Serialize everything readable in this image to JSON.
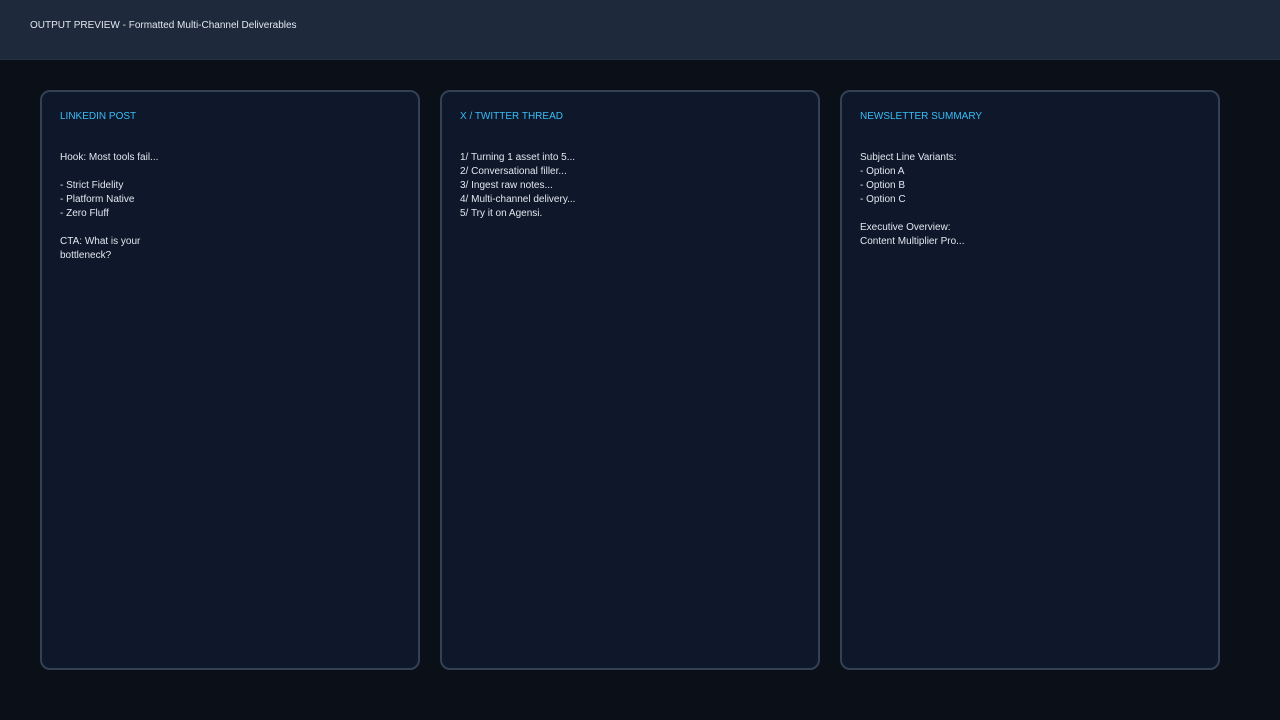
{
  "header": {
    "title": "OUTPUT PREVIEW - Formatted Multi-Channel Deliverables"
  },
  "panels": [
    {
      "heading": "LINKEDIN POST",
      "body": "Hook: Most tools fail...\n\n- Strict Fidelity\n- Platform Native\n- Zero Fluff\n\nCTA: What is your\nbottleneck?"
    },
    {
      "heading": "X / TWITTER THREAD",
      "body": "1/ Turning 1 asset into 5...\n2/ Conversational filler...\n3/ Ingest raw notes...\n4/ Multi-channel delivery...\n5/ Try it on Agensi."
    },
    {
      "heading": "NEWSLETTER SUMMARY",
      "body": "Subject Line Variants:\n- Option A\n- Option B\n- Option C\n\nExecutive Overview:\nContent Multiplier Pro..."
    }
  ],
  "colors": {
    "background": "#0b0f17",
    "topbar": "#1e293b",
    "panel": "#0f172a",
    "panel_border": "#334155",
    "accent": "#38bdf8",
    "text": "#e2e8f0"
  }
}
